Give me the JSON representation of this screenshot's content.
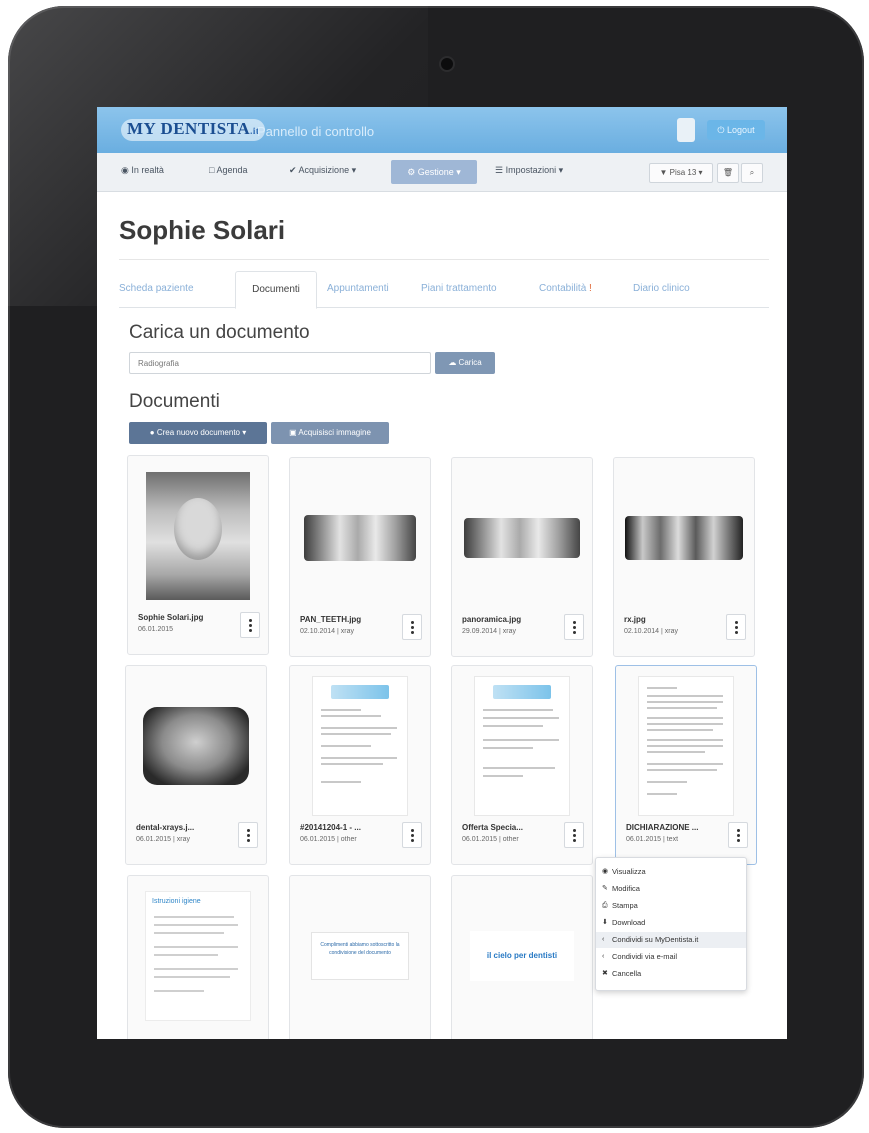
{
  "app": {
    "logo_text": "MY DENTISTA",
    "logo_suffix": ".it",
    "panel_title": "Pannello di controllo",
    "logout_label": "⏻ Logout"
  },
  "navbar": {
    "items": [
      {
        "label": "◉ In realtà",
        "icon": "circle-icon"
      },
      {
        "label": "□ Agenda",
        "icon": "calendar-icon"
      },
      {
        "label": "✔ Acquisizione ▾",
        "icon": "check-icon"
      },
      {
        "label": "⚙ Gestione ▾",
        "icon": "gear-icon",
        "active": true
      },
      {
        "label": "☰ Impostazioni ▾",
        "icon": "settings-icon"
      }
    ],
    "right": {
      "location_label": "▼ Pisa 13 ▾",
      "trash_icon": "trash-icon",
      "search_icon": "search-icon"
    }
  },
  "patient": {
    "name": "Sophie Solari"
  },
  "tabs": [
    {
      "label": "Scheda paziente"
    },
    {
      "label": "Documenti",
      "active": true
    },
    {
      "label": "Appuntamenti"
    },
    {
      "label": "Piani trattamento"
    },
    {
      "label": "Contabilità",
      "alert": "!"
    },
    {
      "label": "Diario clinico"
    }
  ],
  "upload": {
    "heading": "Carica un documento",
    "input_value": "Radiografia",
    "button_label": "☁ Carica"
  },
  "documents": {
    "heading": "Documenti",
    "new_doc_button": "● Crea nuovo documento ▾",
    "acquire_button": "▣ Acquisisci immagine",
    "items": [
      {
        "name": "Sophie Solari.jpg",
        "meta": "06.01.2015",
        "thumb": "portrait"
      },
      {
        "name": "PAN_TEETH.jpg",
        "meta": "02.10.2014 | xray",
        "thumb": "xray-wide"
      },
      {
        "name": "panoramica.jpg",
        "meta": "29.09.2014 | xray",
        "thumb": "xray-panoramic"
      },
      {
        "name": "rx.jpg",
        "meta": "02.10.2014 | xray",
        "thumb": "xray-bite"
      },
      {
        "name": "dental-xrays.j...",
        "meta": "06.01.2015 | xray",
        "thumb": "xray-single"
      },
      {
        "name": "#20141204-1 - ...",
        "meta": "06.01.2015 | other",
        "thumb": "document"
      },
      {
        "name": "Offerta Specia...",
        "meta": "06.01.2015 | other",
        "thumb": "document"
      },
      {
        "name": "DICHIARAZIONE ...",
        "meta": "06.01.2015 | text",
        "thumb": "document-text",
        "selected": true
      },
      {
        "name": "",
        "meta": "",
        "thumb": "igiene",
        "thumb_title": "Istruzioni igiene"
      },
      {
        "name": "",
        "meta": "",
        "thumb": "mini-card",
        "thumb_text": "Complimenti abbiamo sottoscritto la condivisione del documento"
      },
      {
        "name": "",
        "meta": "",
        "thumb": "sky",
        "thumb_text": "il cielo per dentisti"
      }
    ]
  },
  "context_menu": {
    "items": [
      {
        "label": "Visualizza",
        "icon": "eye-icon",
        "glyph": "👁"
      },
      {
        "label": "Modifica",
        "icon": "edit-icon",
        "glyph": "✎"
      },
      {
        "label": "Stampa",
        "icon": "print-icon",
        "glyph": "⎙"
      },
      {
        "label": "Download",
        "icon": "download-icon",
        "glyph": "⬇"
      },
      {
        "label": "Condividi su MyDentista.it",
        "icon": "share-icon",
        "glyph": "‹",
        "highlighted": true
      },
      {
        "label": "Condividi via e-mail",
        "icon": "share-icon",
        "glyph": "‹"
      },
      {
        "label": "Cancella",
        "icon": "delete-icon",
        "glyph": "✖"
      }
    ]
  },
  "colors": {
    "topbar": "#6aaee0",
    "nav_active": "#9fb7d6",
    "button_dark": "#5c7596",
    "tab_link": "#8ab0d8",
    "device_frame": "#1f1f21"
  }
}
